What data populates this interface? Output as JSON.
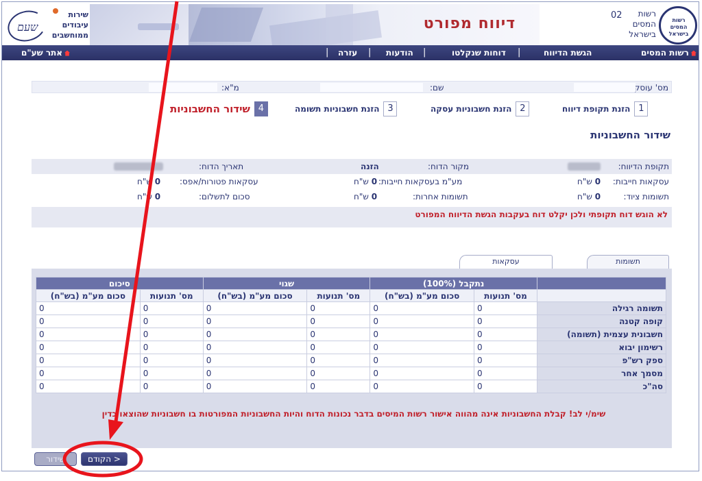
{
  "header": {
    "gov_name": "רשות המסים בישראל",
    "gov_logo_text": "רשות המסים בישראל",
    "page_number": "02",
    "banner_title": "דיווח מפורט",
    "service_name": "שירות עיבודים ממוחשבים",
    "service_logo_sig": "שעם"
  },
  "nav": {
    "home": "רשות המסים",
    "submit": "הגשת הדיווח",
    "shanklat": "דוחות שנקלטו",
    "messages": "הודעות",
    "help": "עזרה",
    "shaam_site": "אתר שע\"ם"
  },
  "dealer": {
    "dealer_no_label": "מס' עוסק:",
    "name_label": "שם:",
    "vat_label": "מ\"א:"
  },
  "steps": [
    {
      "num": "1",
      "label": "הזנת תקופת דיווח"
    },
    {
      "num": "2",
      "label": "הזנת חשבוניות עסקה"
    },
    {
      "num": "3",
      "label": "הזנת חשבוניות תשומה"
    },
    {
      "num": "4",
      "label": "שידור החשבוניות"
    }
  ],
  "section_title": "שידור החשבוניות",
  "summary": {
    "period_label": "תקופת הדיווח:",
    "source_label": "מקור הדוח:",
    "source_value": "הזנה",
    "date_label": "תאריך הדוח:",
    "taxable_label": "עסקאות חייבות:",
    "taxable_value": "0",
    "vat_taxable_label": "מע\"מ בעסקאות חייבות:",
    "vat_taxable_value": "0",
    "exempt_label": "עסקאות פטורות/אפס:",
    "exempt_value": "0",
    "equipment_label": "תשומות ציוד:",
    "equipment_value": "0",
    "other_label": "תשומות אחרות:",
    "other_value": "0",
    "payment_label": "סכום לתשלום:",
    "payment_value": "0",
    "currency": "ש\"ח",
    "warning": "לא הוגש דוח תקופתי ולכן יקלט דוח בעקבות הגשת הדיווח המפורט"
  },
  "tabs": {
    "inputs": "תשומות",
    "deals": "עסקאות"
  },
  "table": {
    "groups": [
      "נתקבל (100%)",
      "שגוי",
      "סיכום"
    ],
    "col_count": "מס' תנועות",
    "col_vat": "סכום מע\"מ (בש\"ח)",
    "rows": [
      {
        "label": "תשומה רגילה",
        "values": [
          "0",
          "0",
          "0",
          "0",
          "0",
          "0"
        ]
      },
      {
        "label": "קופה קטנה",
        "values": [
          "0",
          "0",
          "0",
          "0",
          "0",
          "0"
        ]
      },
      {
        "label": "חשבונית עצמית (תשומה)",
        "values": [
          "0",
          "0",
          "0",
          "0",
          "0",
          "0"
        ]
      },
      {
        "label": "רשימון יבוא",
        "values": [
          "0",
          "0",
          "0",
          "0",
          "0",
          "0"
        ]
      },
      {
        "label": "ספק רש\"פ",
        "values": [
          "0",
          "0",
          "0",
          "0",
          "0",
          "0"
        ]
      },
      {
        "label": "מסמך אחר",
        "values": [
          "0",
          "0",
          "0",
          "0",
          "0",
          "0"
        ]
      },
      {
        "label": "סה\"כ",
        "values": [
          "0",
          "0",
          "0",
          "0",
          "0",
          "0"
        ]
      }
    ],
    "note": "שימ/י לב! קבלת החשבוניות אינה מהווה אישור רשות המיסים בדבר נכונות הדוח והיות החשבוניות המפורטות בו חשבוניות שהוצאו כדין"
  },
  "buttons": {
    "prev": "< הקודם",
    "send": "שידור"
  },
  "colors": {
    "nav": "#2b3166",
    "accent_red": "#c0202a",
    "annotation": "#e8141c"
  }
}
